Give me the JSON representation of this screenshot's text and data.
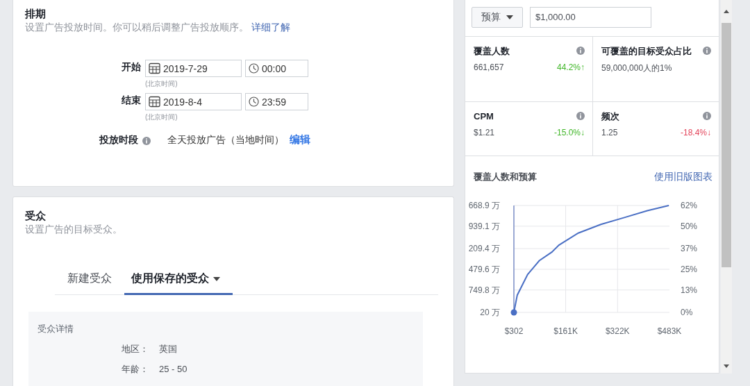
{
  "schedule": {
    "title": "排期",
    "subtitle": "设置广告投放时间。你可以稍后调整广告投放顺序。",
    "link": "详细了解",
    "rows": [
      {
        "label": "开始",
        "date": "2019-7-29",
        "time": "00:00",
        "note": "(北京时间)"
      },
      {
        "label": "结束",
        "date": "2019-8-4",
        "time": "23:59",
        "note": "(北京时间)"
      }
    ],
    "delivery": {
      "label": "投放时段",
      "value": "全天投放广告（当地时间）",
      "link": "编辑"
    }
  },
  "audience": {
    "title": "受众",
    "subtitle": "设置广告的目标受众。",
    "tabs": [
      {
        "label": "新建受众",
        "selected": false,
        "dropdown": false
      },
      {
        "label": "使用保存的受众",
        "selected": true,
        "dropdown": true
      }
    ],
    "details": {
      "title": "受众详情",
      "rows": [
        {
          "label": "地区：",
          "value": "英国"
        },
        {
          "label": "年龄：",
          "value": "25 - 50"
        }
      ]
    }
  },
  "budget": {
    "type": "预算",
    "amount": "$1,000.00"
  },
  "metrics": [
    {
      "title": "覆盖人数",
      "value": "661,657",
      "change": "44.2%↑",
      "color": "#42b72a"
    },
    {
      "title": "可覆盖的目标受众占比",
      "value": "59,000,000人的1%"
    },
    {
      "title": "CPM",
      "value": "$1.21",
      "change": "-15.0%↓",
      "color": "#42b72a"
    },
    {
      "title": "频次",
      "value": "1.25",
      "change": "-18.4%↓",
      "color": "#e3445a"
    }
  ],
  "chart": {
    "title": "覆盖人数和预算",
    "link": "使用旧版图表",
    "left_axis_labels": [
      "668.9 万",
      "939.1 万",
      "209.4 万",
      "479.6 万",
      "749.8 万",
      "20 万"
    ],
    "chart_data": {
      "type": "line",
      "x": [
        302,
        10700,
        43000,
        79000,
        118000,
        140000,
        200000,
        270000,
        343000,
        414000,
        481000
      ],
      "series": [
        {
          "color": "#4a6fc4",
          "values": [
            0,
            10,
            22,
            30,
            35,
            39,
            46,
            51,
            55,
            59,
            62
          ]
        }
      ],
      "xlim": [
        302,
        483000
      ],
      "ylim": [
        0,
        62
      ],
      "grid": true,
      "xticks": [
        {
          "value": 302,
          "label": "$302"
        },
        {
          "value": 161000,
          "label": "$161K"
        },
        {
          "value": 322000,
          "label": "$322K"
        },
        {
          "value": 483000,
          "label": "$483K"
        }
      ],
      "yticks": [
        {
          "value": 0,
          "label": "0%"
        },
        {
          "value": 13,
          "label": "13%"
        },
        {
          "value": 25,
          "label": "25%"
        },
        {
          "value": 37,
          "label": "37%"
        },
        {
          "value": 50,
          "label": "50%"
        },
        {
          "value": 62,
          "label": "62%"
        }
      ]
    }
  }
}
